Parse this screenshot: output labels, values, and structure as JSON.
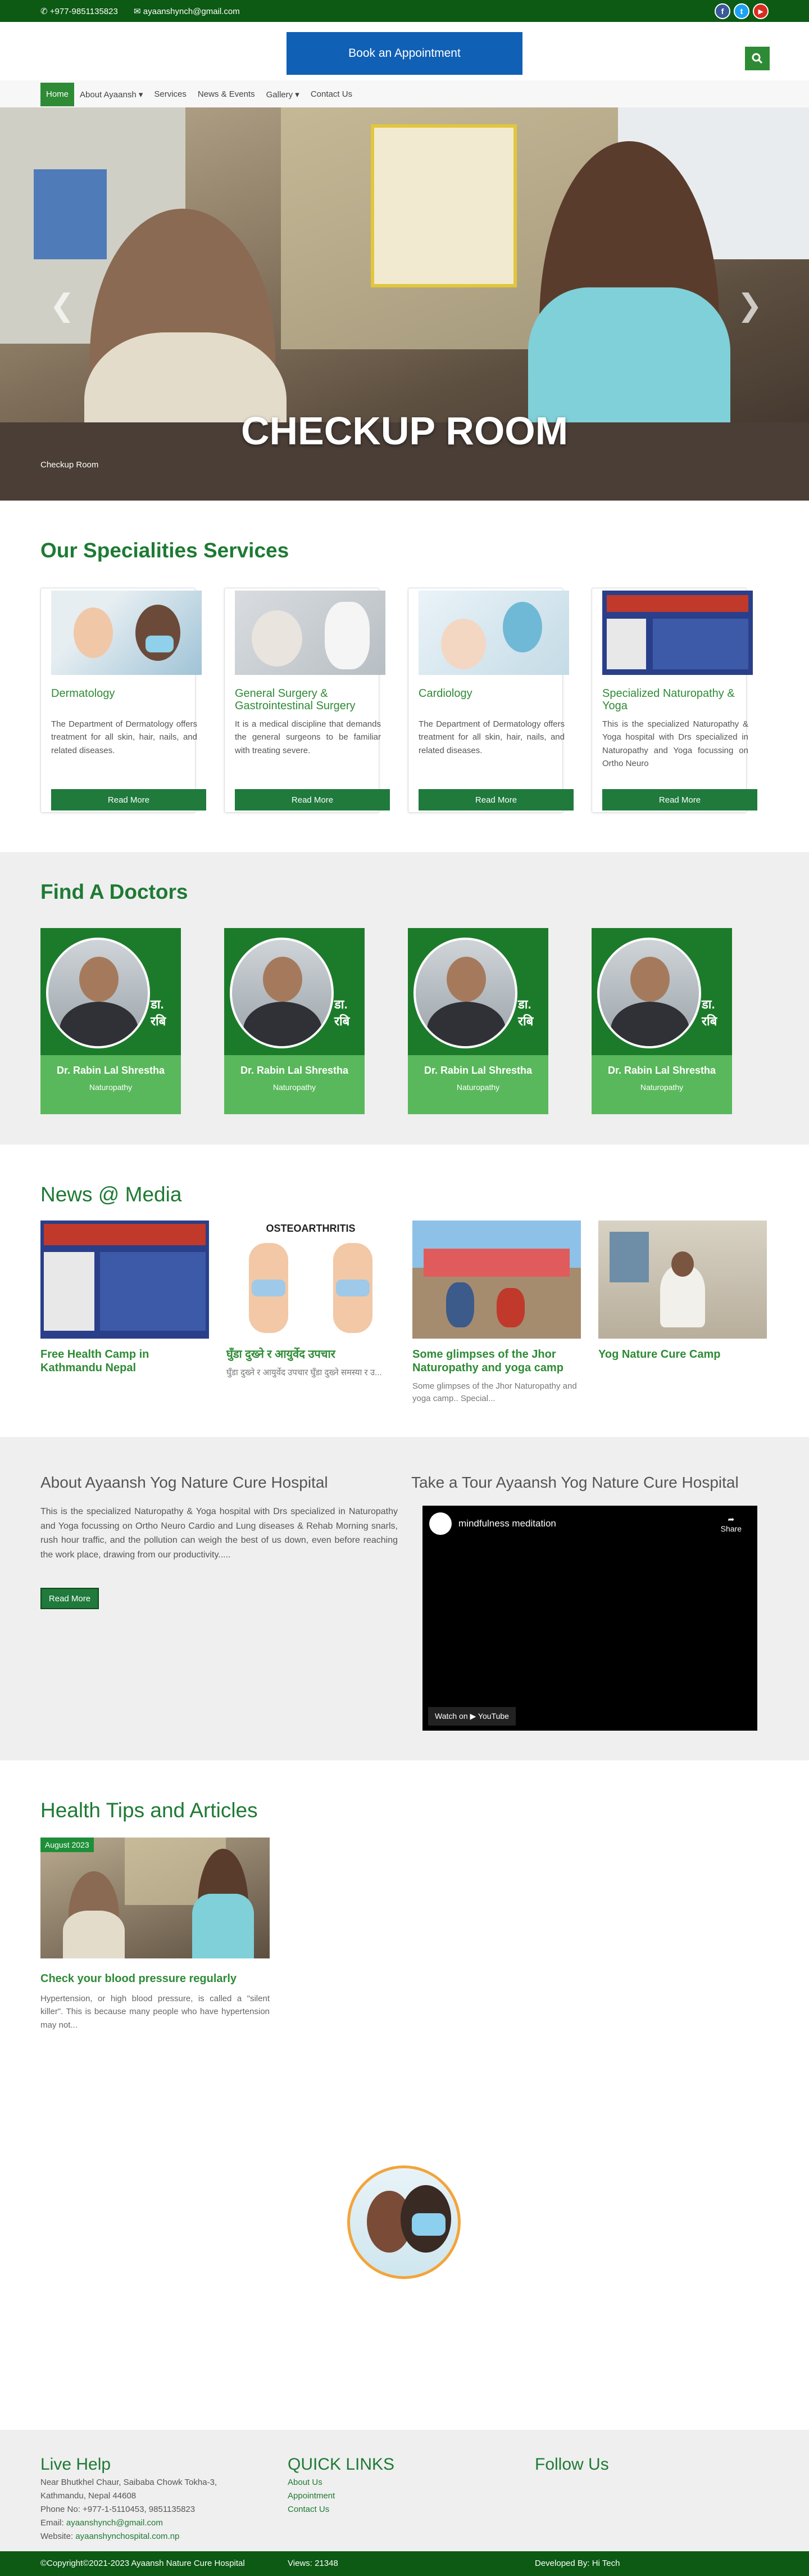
{
  "topbar": {
    "phone": "+977-9851135823",
    "email": "ayaanshynch@gmail.com",
    "social": [
      "f",
      "t",
      "▶"
    ]
  },
  "header": {
    "book_label": "Book an Appointment",
    "search_icon": "search-icon"
  },
  "nav": {
    "items": [
      "Home",
      "About Ayaansh ▾",
      "Services",
      "News & Events",
      "Gallery ▾",
      "Contact Us"
    ]
  },
  "hero": {
    "title": "CHECKUP ROOM",
    "caption": "Checkup Room",
    "prev": "❮",
    "next": "❯"
  },
  "specialities": {
    "title": "Our Specialities Services",
    "read_more": "Read More",
    "cards": [
      {
        "title": "Dermatology",
        "text": "The Department of Dermatology offers treatment for all skin, hair, nails, and related diseases."
      },
      {
        "title": "General Surgery & Gastrointestinal Surgery",
        "text": "It is a medical discipline that demands the general surgeons to be familiar with treating severe."
      },
      {
        "title": "Cardiology",
        "text": "The Department of Dermatology offers treatment for all skin, hair, nails, and related diseases."
      },
      {
        "title": "Specialized Naturopathy & Yoga",
        "text": "This is the specialized Naturopathy & Yoga hospital with Drs specialized in Naturopathy and Yoga focussing on Ortho Neuro"
      }
    ]
  },
  "doctors": {
    "title": "Find A Doctors",
    "cards": [
      {
        "name": "Dr. Rabin Lal Shrestha",
        "spec": "Naturopathy",
        "overlay": "डा. रबि"
      },
      {
        "name": "Dr. Rabin Lal Shrestha",
        "spec": "Naturopathy",
        "overlay": "डा. रबि"
      },
      {
        "name": "Dr. Rabin Lal Shrestha",
        "spec": "Naturopathy",
        "overlay": "डा. रबि"
      },
      {
        "name": "Dr. Rabin Lal Shrestha",
        "spec": "Naturopathy",
        "overlay": "डा. रबि"
      }
    ]
  },
  "news": {
    "title": "News @ Media",
    "cards": [
      {
        "title": "Free Health Camp in Kathmandu Nepal",
        "text": ""
      },
      {
        "title": "घुँडा दुख्ने र आयुर्वेद उपचार",
        "text": "घुँडा दुख्ने र आयुर्वेद उपचार घुँडा दुख्ने समस्या र उ...",
        "img_title": "OSTEOARTHRITIS"
      },
      {
        "title": "Some glimpses of the Jhor Naturopathy and yoga camp",
        "text": "Some glimpses of the Jhor Naturopathy and yoga camp.. Special..."
      },
      {
        "title": "Yog Nature Cure Camp",
        "text": ""
      }
    ]
  },
  "about": {
    "title": "About Ayaansh Yog Nature Cure Hospital",
    "text": "This is the specialized Naturopathy & Yoga hospital with Drs specialized in Naturopathy and Yoga focussing on Ortho Neuro Cardio and Lung diseases & Rehab Morning snarls, rush hour traffic, and the pollution can weigh the best of us down, even before reaching the work place, drawing from our productivity.....",
    "read_more": "Read More",
    "tour_title": "Take a Tour Ayaansh Yog Nature Cure Hospital",
    "video_title": "mindfulness meditation",
    "share": "Share",
    "watch_on": "Watch on ▶ YouTube"
  },
  "tips": {
    "title": "Health Tips and Articles",
    "article": {
      "date": "August 2023",
      "title": "Check your blood pressure regularly",
      "text": "Hypertension, or high blood pressure, is called a \"silent killer\". This is because many people who have hypertension may not..."
    }
  },
  "footer": {
    "live_help": "Live Help",
    "address1": "Near Bhutkhel Chaur, Saibaba Chowk Tokha-3,",
    "address2": "Kathmandu, Nepal 44608",
    "phone": "Phone No: +977-1-5110453, 9851135823",
    "email_label": "Email:",
    "email": "ayaanshynch@gmail.com",
    "website_label": "Website:",
    "website": "ayaanshynchospital.com.np",
    "quick_links": "QUICK LINKS",
    "links": [
      "About Us",
      "Appointment",
      "Contact Us"
    ],
    "follow_us": "Follow Us",
    "copyright": "©Copyright©2021-2023 Ayaansh Nature Cure Hospital",
    "views": "Views: 21348",
    "developed": "Developed By: Hi Tech"
  },
  "colors": {
    "green_dark": "#0c5a13",
    "green": "#2e8b35",
    "blue": "#1060b5"
  }
}
